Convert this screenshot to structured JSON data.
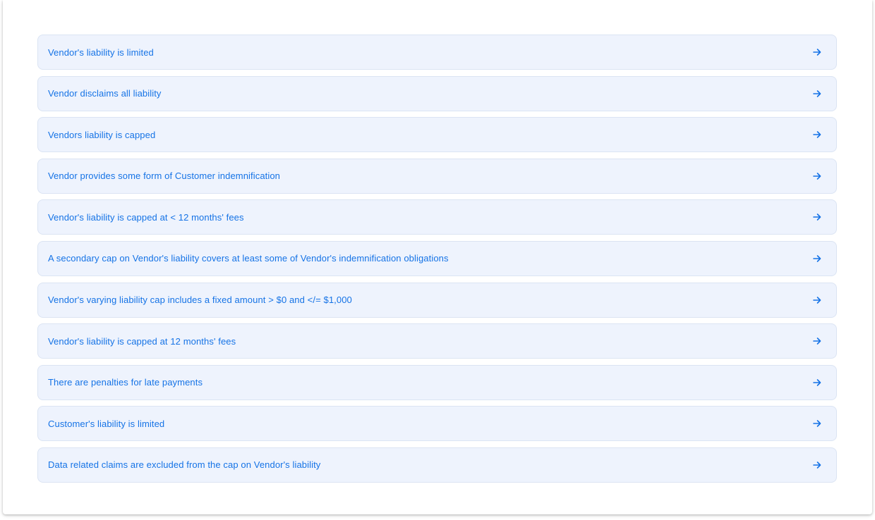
{
  "colors": {
    "accent": "#1573e6",
    "item_background": "#eef3fd",
    "item_border": "#dbe4f3"
  },
  "items": [
    {
      "label": "Vendor's liability is limited",
      "icon": "arrow-right-icon"
    },
    {
      "label": "Vendor disclaims all liability",
      "icon": "arrow-right-icon"
    },
    {
      "label": "Vendors liability is capped",
      "icon": "arrow-right-icon"
    },
    {
      "label": "Vendor provides some form of Customer indemnification",
      "icon": "arrow-right-icon"
    },
    {
      "label": "Vendor's liability is capped at < 12 months' fees",
      "icon": "arrow-right-icon"
    },
    {
      "label": "A secondary cap on Vendor's liability covers at least some of Vendor's indemnification obligations",
      "icon": "arrow-right-icon"
    },
    {
      "label": "Vendor's varying liability cap includes a fixed amount > $0 and </= $1,000",
      "icon": "arrow-right-icon"
    },
    {
      "label": "Vendor's liability is capped at 12 months' fees",
      "icon": "arrow-right-icon"
    },
    {
      "label": "There are penalties for late payments",
      "icon": "arrow-right-icon"
    },
    {
      "label": "Customer's liability is limited",
      "icon": "arrow-right-icon"
    },
    {
      "label": "Data related claims are excluded from the cap on Vendor's liability",
      "icon": "arrow-right-icon"
    }
  ]
}
